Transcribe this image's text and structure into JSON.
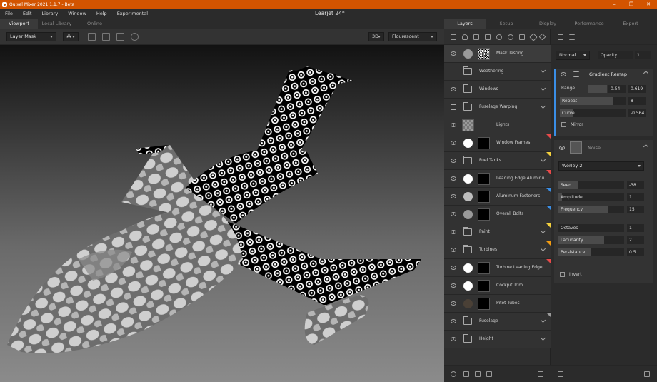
{
  "app": {
    "title": "Quixel Mixer 2021.1.1.7 - Beta",
    "document": "Learjet 24*"
  },
  "menu": [
    "File",
    "Edit",
    "Library",
    "Window",
    "Help",
    "Experimental"
  ],
  "left_tabs": [
    "Viewport",
    "Local Library",
    "Online"
  ],
  "viewport": {
    "mask_mode": "Layer Mask",
    "view_mode": "3D",
    "lighting": "Flourescent"
  },
  "right_tabs": [
    "Layers",
    "Setup",
    "Display",
    "Performance",
    "Export"
  ],
  "layers": [
    {
      "name": "Mask Testing",
      "kind": "layer",
      "vis": "eye",
      "swatch": "#9a9a9a",
      "thumb": "pattern",
      "selected": true
    },
    {
      "name": "Weathering",
      "kind": "folder",
      "vis": "box"
    },
    {
      "name": "Windows",
      "kind": "folder",
      "vis": "eye"
    },
    {
      "name": "Fuselage Warping",
      "kind": "folder",
      "vis": "box"
    },
    {
      "name": "Lights",
      "kind": "layer",
      "vis": "eye",
      "thumb": "checker"
    },
    {
      "name": "Window Frames",
      "kind": "layer",
      "vis": "eye",
      "swatch": "#ffffff",
      "thumb": "black",
      "flag": "#e84a4a"
    },
    {
      "name": "Fuel Tanks",
      "kind": "folder",
      "vis": "eye",
      "flag": "#f3d03e"
    },
    {
      "name": "Leading Edge Aluminu",
      "kind": "layer",
      "vis": "eye",
      "swatch": "#ffffff",
      "thumb": "black",
      "flag": "#e84a4a"
    },
    {
      "name": "Aluminum Fasteners",
      "kind": "layer",
      "vis": "eye",
      "swatch": "#bdbdbd",
      "thumb": "black",
      "flag": "#3a8ee6"
    },
    {
      "name": "Overall Bolts",
      "kind": "layer",
      "vis": "eye",
      "swatch": "#9a9a9a",
      "thumb": "black",
      "flag": "#3a8ee6"
    },
    {
      "name": "Paint",
      "kind": "folder",
      "vis": "eye",
      "flag": "#f3d03e"
    },
    {
      "name": "Turbines",
      "kind": "folder",
      "vis": "eye",
      "flag": "#f39c12"
    },
    {
      "name": "Turbine Leading Edge",
      "kind": "layer",
      "vis": "eye",
      "swatch": "#ffffff",
      "thumb": "black",
      "flag": "#e84a4a"
    },
    {
      "name": "Cockpit Trim",
      "kind": "layer",
      "vis": "eye",
      "swatch": "#ffffff",
      "thumb": "black"
    },
    {
      "name": "Pitot Tubes",
      "kind": "layer",
      "vis": "eye",
      "swatch": "#4a4036",
      "thumb": "black"
    },
    {
      "name": "Fuselage",
      "kind": "folder",
      "vis": "eye",
      "flag": "#9a9a9a"
    },
    {
      "name": "Height",
      "kind": "folder",
      "vis": "eye"
    }
  ],
  "properties": {
    "blend_mode": "Normal",
    "opacity_label": "Opacity",
    "opacity_value": "1",
    "gradient_remap": {
      "title": "Gradient Remap",
      "range_label": "Range",
      "range_min": "0.54",
      "range_max": "0.619",
      "repeat_label": "Repeat",
      "repeat_value": "8",
      "curve_label": "Curve",
      "curve_value": "-0.564",
      "mirror_label": "Mirror"
    },
    "noise": {
      "title": "Noise",
      "type": "Worley 2",
      "seed_label": "Seed",
      "seed_value": "-38",
      "seed_fill": 0.3,
      "amplitude_label": "Amplitude",
      "amplitude_value": "1",
      "amplitude_fill": 0.05,
      "frequency_label": "Frequency",
      "frequency_value": "15",
      "frequency_fill": 0.75,
      "octaves_label": "Octaves",
      "octaves_value": "1",
      "octaves_fill": 0.0,
      "lacunarity_label": "Lacunarity",
      "lacunarity_value": "2",
      "lacunarity_fill": 0.7,
      "persistance_label": "Persistance",
      "persistance_value": "0.5",
      "persistance_fill": 0.5,
      "invert_label": "Invert"
    }
  },
  "colors": {
    "titlebar": "#d35400",
    "accent": "#3a8ee6"
  }
}
